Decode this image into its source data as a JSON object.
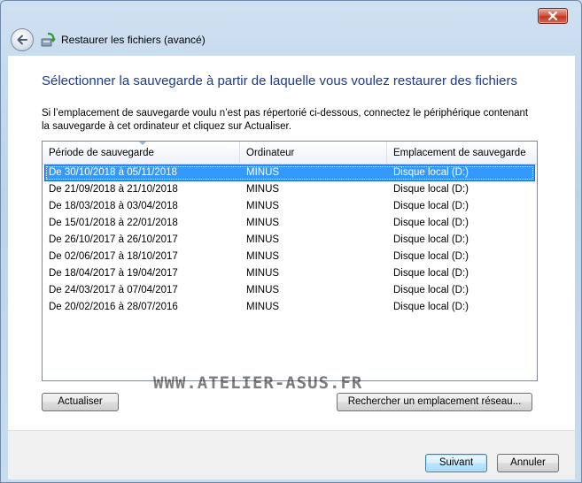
{
  "window": {
    "title": "Restaurer les fichiers (avancé)",
    "close_icon": "close-icon",
    "back_icon": "back-arrow-icon"
  },
  "main": {
    "heading": "Sélectionner la sauvegarde à partir de laquelle vous voulez restaurer des fichiers",
    "instructions": "Si l’emplacement de sauvegarde voulu n’est pas répertorié ci-dessous, connectez le périphérique contenant la sauvegarde à cet ordinateur et cliquez sur Actualiser."
  },
  "table": {
    "columns": [
      "Période de sauvegarde",
      "Ordinateur",
      "Emplacement de sauvegarde"
    ],
    "rows": [
      {
        "period": "De 30/10/2018 à 05/11/2018",
        "computer": "MINUS",
        "location": "Disque local (D:)",
        "selected": true
      },
      {
        "period": "De 21/09/2018 à 21/10/2018",
        "computer": "MINUS",
        "location": "Disque local (D:)"
      },
      {
        "period": "De 18/03/2018 à 03/04/2018",
        "computer": "MINUS",
        "location": "Disque local (D:)"
      },
      {
        "period": "De 15/01/2018 à 22/01/2018",
        "computer": "MINUS",
        "location": "Disque local (D:)"
      },
      {
        "period": "De 26/10/2017 à 26/10/2017",
        "computer": "MINUS",
        "location": "Disque local (D:)"
      },
      {
        "period": "De 02/06/2017 à 18/10/2017",
        "computer": "MINUS",
        "location": "Disque local (D:)"
      },
      {
        "period": "De 18/04/2017 à 19/04/2017",
        "computer": "MINUS",
        "location": "Disque local (D:)"
      },
      {
        "period": "De 24/03/2017 à 07/04/2017",
        "computer": "MINUS",
        "location": "Disque local (D:)"
      },
      {
        "period": "De 20/02/2016 à 28/07/2016",
        "computer": "MINUS",
        "location": "Disque local (D:)"
      }
    ]
  },
  "buttons": {
    "refresh": "Actualiser",
    "browse_network": "Rechercher un emplacement réseau...",
    "next": "Suivant",
    "cancel": "Annuler"
  },
  "watermark": "WWW.ATELIER-ASUS.FR",
  "colors": {
    "heading": "#1e3b8b",
    "selection": "#3399ff"
  }
}
